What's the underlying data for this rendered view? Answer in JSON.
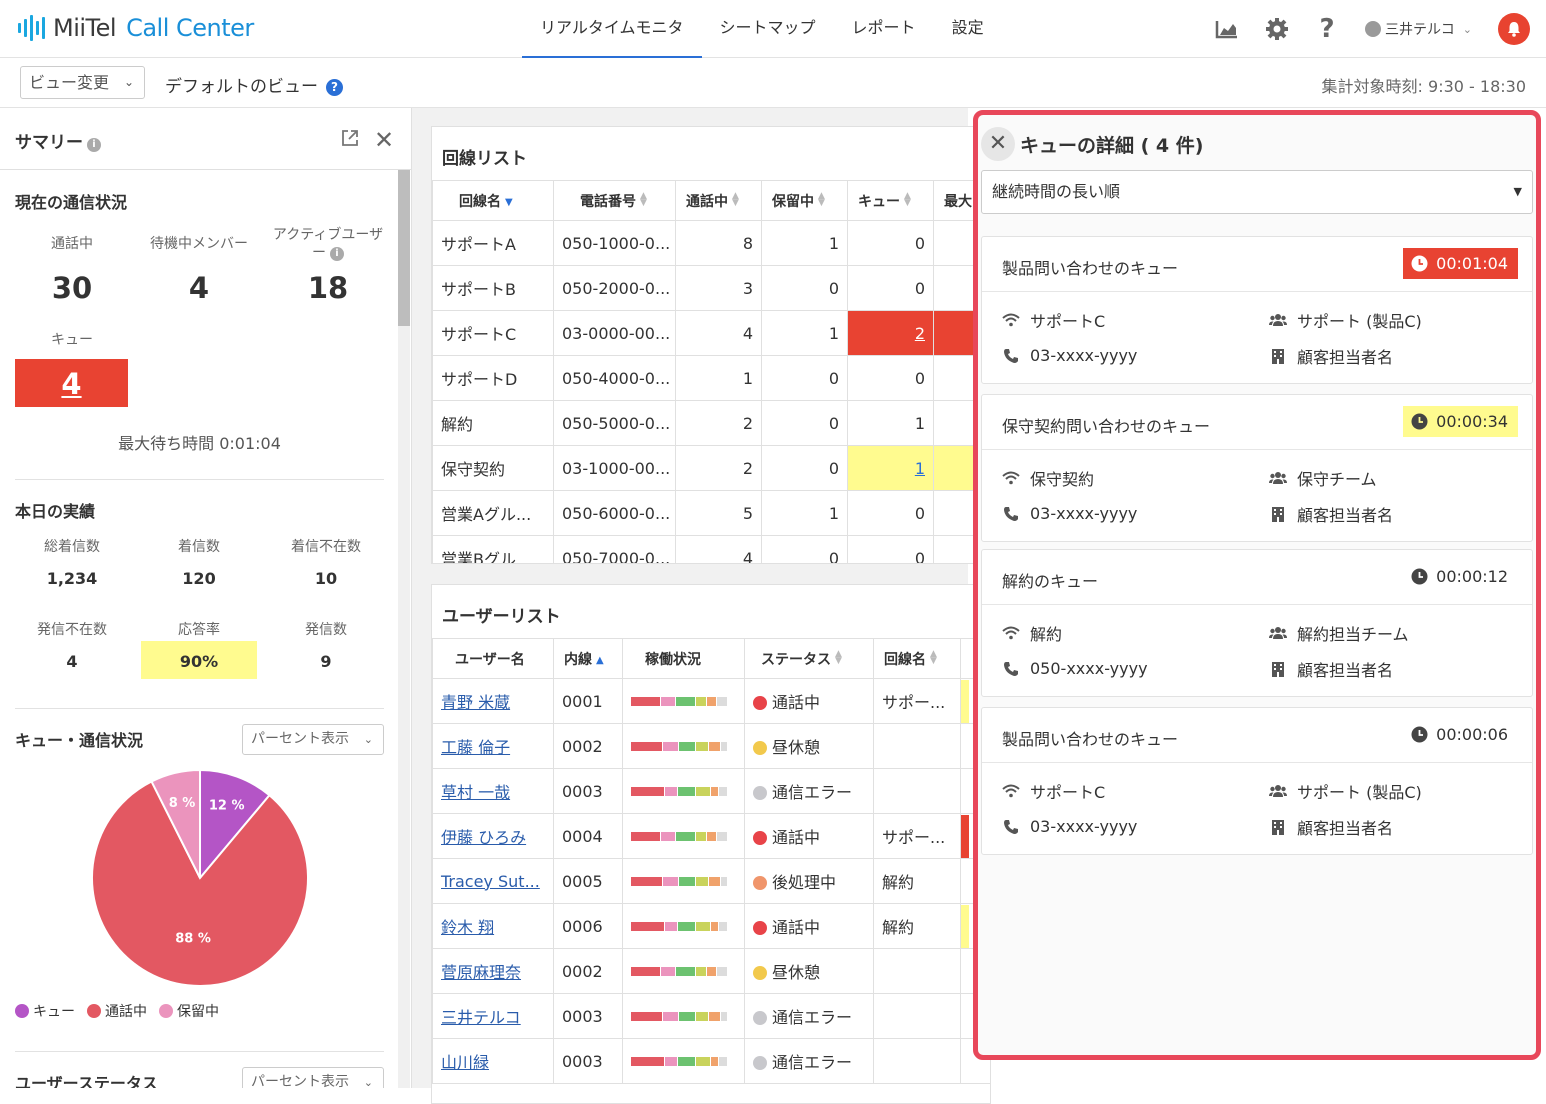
{
  "brand": {
    "name": "MiiTel",
    "product": "Call Center",
    "accent": "#1a8fd8"
  },
  "nav": {
    "tabs": [
      {
        "label": "リアルタイムモニタ"
      },
      {
        "label": "シートマップ"
      },
      {
        "label": "レポート"
      },
      {
        "label": "設定"
      }
    ],
    "active": 0
  },
  "header_icons": [
    "chart-icon",
    "gear-icon",
    "help-icon",
    "user-icon",
    "bell-icon"
  ],
  "user": {
    "name": "三井テルコ"
  },
  "subbar": {
    "view_button": "ビュー変更",
    "view_name": "デフォルトのビュー",
    "agg_time": "集計対象時刻: 9:30 - 18:30"
  },
  "summary": {
    "title": "サマリー",
    "current_title": "現在の通信状況",
    "current": {
      "calling_label": "通話中",
      "calling_value": "30",
      "waiting_label": "待機中メンバー",
      "waiting_value": "4",
      "active_label": "アクティブユーザー",
      "active_value": "18",
      "queue_label": "キュー",
      "queue_value": "4",
      "max_wait": "最大待ち時間 0:01:04"
    },
    "today_title": "本日の実績",
    "today": [
      {
        "label": "総着信数",
        "value": "1,234"
      },
      {
        "label": "着信数",
        "value": "120"
      },
      {
        "label": "着信不在数",
        "value": "10"
      },
      {
        "label": "発信不在数",
        "value": "4"
      },
      {
        "label": "応答率",
        "value": "90%"
      },
      {
        "label": "発信数",
        "value": "9"
      }
    ],
    "queue_title": "キュー・通信状況",
    "percent_select": "パーセント表示",
    "user_status_title": "ユーザーステータス",
    "percent_select2": "パーセント表示"
  },
  "chart_data": {
    "type": "pie",
    "labels": [
      "キュー",
      "通話中",
      "保留中"
    ],
    "values": [
      12,
      88,
      8
    ],
    "value_labels": [
      "12 %",
      "88 %",
      "8 %"
    ],
    "colors": [
      "#b455c6",
      "#e35862",
      "#eb94bd"
    ],
    "legend": "bottom-left"
  },
  "line_list": {
    "title": "回線リスト",
    "columns": [
      "回線名",
      "電話番号",
      "通話中",
      "保留中",
      "キュー",
      "最大"
    ],
    "rows": [
      {
        "name": "サポートA",
        "phone": "050-1000-0...",
        "calling": "8",
        "hold": "1",
        "queue": "0",
        "q_state": ""
      },
      {
        "name": "サポートB",
        "phone": "050-2000-0...",
        "calling": "3",
        "hold": "0",
        "queue": "0",
        "q_state": ""
      },
      {
        "name": "サポートC",
        "phone": "03-0000-00...",
        "calling": "4",
        "hold": "1",
        "queue": "2",
        "q_state": "red"
      },
      {
        "name": "サポートD",
        "phone": "050-4000-0...",
        "calling": "1",
        "hold": "0",
        "queue": "0",
        "q_state": ""
      },
      {
        "name": "解約",
        "phone": "050-5000-0...",
        "calling": "2",
        "hold": "0",
        "queue": "1",
        "q_state": ""
      },
      {
        "name": "保守契約",
        "phone": "03-1000-00...",
        "calling": "2",
        "hold": "0",
        "queue": "1",
        "q_state": "yellow"
      },
      {
        "name": "営業Aグル...",
        "phone": "050-6000-0...",
        "calling": "5",
        "hold": "1",
        "queue": "0",
        "q_state": ""
      },
      {
        "name": "営業Bグル...",
        "phone": "050-7000-0...",
        "calling": "4",
        "hold": "0",
        "queue": "0",
        "q_state": ""
      }
    ]
  },
  "user_list": {
    "title": "ユーザーリスト",
    "columns": [
      "ユーザー名",
      "内線",
      "稼働状況",
      "ステータス",
      "回線名"
    ],
    "rows": [
      {
        "name": "青野 米蔵",
        "ext": "0001",
        "status": "通話中",
        "status_color": "#e84348",
        "line": "サポー...",
        "flag": "#fffb8f"
      },
      {
        "name": "工藤 倫子",
        "ext": "0002",
        "status": "昼休憩",
        "status_color": "#f2c94c",
        "line": "",
        "flag": ""
      },
      {
        "name": "草村 一哉",
        "ext": "0003",
        "status": "通信エラー",
        "status_color": "#c8c8cc",
        "line": "",
        "flag": ""
      },
      {
        "name": "伊藤 ひろみ",
        "ext": "0004",
        "status": "通話中",
        "status_color": "#e84348",
        "line": "サポー...",
        "flag": "#e84332"
      },
      {
        "name": "Tracey Sut...",
        "ext": "0005",
        "status": "後処理中",
        "status_color": "#f0956b",
        "line": "解約",
        "flag": ""
      },
      {
        "name": "鈴木 翔",
        "ext": "0006",
        "status": "通話中",
        "status_color": "#e84348",
        "line": "解約",
        "flag": "#fffb8f"
      },
      {
        "name": "菅原麻理奈",
        "ext": "0002",
        "status": "昼休憩",
        "status_color": "#f2c94c",
        "line": "",
        "flag": ""
      },
      {
        "name": "三井テルコ",
        "ext": "0003",
        "status": "通信エラー",
        "status_color": "#c8c8cc",
        "line": "",
        "flag": ""
      },
      {
        "name": "山川緑",
        "ext": "0003",
        "status": "通信エラー",
        "status_color": "#c8c8cc",
        "line": "",
        "flag": ""
      }
    ]
  },
  "queue_detail": {
    "title": "キューの詳細 ( 4 件)",
    "sort": "継続時間の長い順",
    "items": [
      {
        "name": "製品問い合わせのキュー",
        "time": "00:01:04",
        "level": "red",
        "line": "サポートC",
        "team": "サポート (製品C)",
        "phone": "03-xxxx-yyyy",
        "owner": "顧客担当者名"
      },
      {
        "name": "保守契約問い合わせのキュー",
        "time": "00:00:34",
        "level": "yellow",
        "line": "保守契約",
        "team": "保守チーム",
        "phone": "03-xxxx-yyyy",
        "owner": "顧客担当者名"
      },
      {
        "name": "解約のキュー",
        "time": "00:00:12",
        "level": "plain",
        "line": "解約",
        "team": "解約担当チーム",
        "phone": "050-xxxx-yyyy",
        "owner": "顧客担当者名"
      },
      {
        "name": "製品問い合わせのキュー",
        "time": "00:00:06",
        "level": "plain",
        "line": "サポートC",
        "team": "サポート (製品C)",
        "phone": "03-xxxx-yyyy",
        "owner": "顧客担当者名"
      }
    ]
  }
}
